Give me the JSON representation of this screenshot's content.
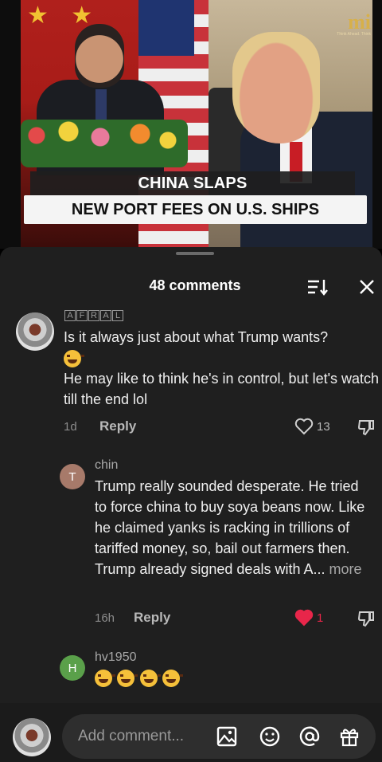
{
  "video": {
    "logo_mark": "mi",
    "logo_tagline": "Think Ahead. Think",
    "headline_line1": "CHINA SLAPS",
    "headline_line2": "NEW PORT FEES ON U.S. SHIPS"
  },
  "comments_panel": {
    "title": "48 comments",
    "icons": {
      "sort": "sort-icon",
      "close": "close-icon"
    }
  },
  "comments": [
    {
      "author": "AFRAL",
      "author_style": "boxed-letters",
      "avatar": "photo",
      "text_line1": "Is it always just about what Trump wants?",
      "text_line2": "He may like to think he's in control, but let's watch till the end lol",
      "time": "1d",
      "reply_label": "Reply",
      "likes": "13",
      "liked": false
    },
    {
      "author": "chin",
      "avatar_letter": "T",
      "avatar_color": "#a77a6a",
      "text": "Trump really sounded desperate. He tried to force china to buy soya beans now. Like he claimed yanks is racking in trillions of tariffed money, so, bail out farmers then. Trump already signed deals with A...",
      "more_label": "more",
      "time": "16h",
      "reply_label": "Reply",
      "likes": "1",
      "liked": true
    },
    {
      "author": "hv1950",
      "avatar_letter": "H",
      "avatar_color": "#5aa04a",
      "emoji_count": 4,
      "emoji_name": "rolling-on-floor-laughing"
    }
  ],
  "comment_input": {
    "placeholder": "Add comment...",
    "icons": [
      "image-icon",
      "emoji-icon",
      "mention-icon",
      "gift-icon"
    ]
  },
  "colors": {
    "sheet_bg": "#1f1f1f",
    "like_red": "#e8264a"
  }
}
